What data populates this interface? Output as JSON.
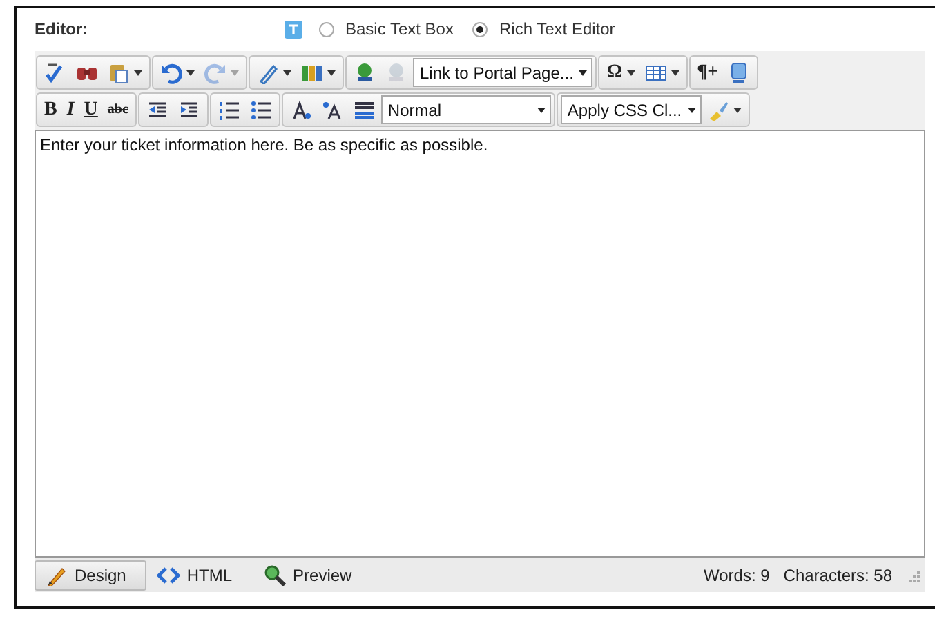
{
  "editor_label": "Editor:",
  "mode_options": [
    {
      "label": "Basic Text Box",
      "selected": false
    },
    {
      "label": "Rich Text Editor",
      "selected": true
    }
  ],
  "toolbar_rows": [
    [
      {
        "tools": [
          {
            "kind": "spellcheck"
          },
          {
            "kind": "find"
          },
          {
            "kind": "paste",
            "has_menu": true
          }
        ]
      },
      {
        "tools": [
          {
            "kind": "undo",
            "has_menu": true
          },
          {
            "kind": "redo",
            "has_menu": true,
            "disabled": true
          }
        ]
      },
      {
        "tools": [
          {
            "kind": "pen",
            "has_menu": true
          },
          {
            "kind": "gallery",
            "has_menu": true
          }
        ]
      },
      {
        "tools": [
          {
            "kind": "hyperlink"
          },
          {
            "kind": "unlink",
            "disabled": true
          },
          {
            "kind": "select",
            "value": "Link to Portal Page..."
          }
        ]
      },
      {
        "tools": [
          {
            "kind": "text",
            "label": "Ω",
            "has_menu": true
          },
          {
            "kind": "table",
            "has_menu": true
          }
        ]
      },
      {
        "tools": [
          {
            "kind": "text",
            "label": "¶+"
          },
          {
            "kind": "module"
          }
        ]
      }
    ],
    [
      {
        "tools": [
          {
            "kind": "text",
            "label": "B"
          },
          {
            "kind": "text",
            "label": "I",
            "italic": true
          },
          {
            "kind": "text",
            "label": "U",
            "underline": true
          },
          {
            "kind": "text",
            "label": "abc",
            "strike": true
          }
        ]
      },
      {
        "tools": [
          {
            "kind": "outdent"
          },
          {
            "kind": "indent"
          }
        ]
      },
      {
        "tools": [
          {
            "kind": "numbered"
          },
          {
            "kind": "bulleted"
          }
        ]
      },
      {
        "tools": [
          {
            "kind": "superscript"
          },
          {
            "kind": "subscript"
          },
          {
            "kind": "align"
          },
          {
            "kind": "select",
            "value": "Normal",
            "wide": true
          }
        ]
      },
      {
        "tools": [
          {
            "kind": "select",
            "value": "Apply CSS Cl..."
          },
          {
            "kind": "brush",
            "has_menu": true
          }
        ]
      }
    ]
  ],
  "content": "Enter your ticket information here. Be as specific as possible.",
  "view_tabs": [
    {
      "kind": "design",
      "label": "Design",
      "selected": true
    },
    {
      "kind": "html",
      "label": "HTML",
      "selected": false
    },
    {
      "kind": "preview",
      "label": "Preview",
      "selected": false
    }
  ],
  "status": [
    "Words: 9",
    "Characters: 58"
  ]
}
